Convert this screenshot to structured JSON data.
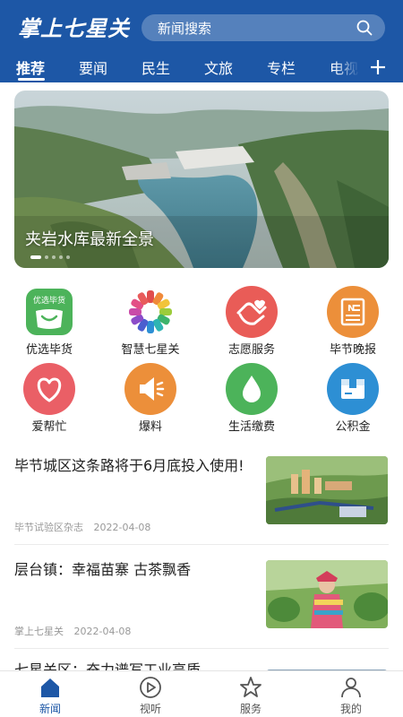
{
  "header": {
    "logo_text": "掌上七星关",
    "search_placeholder": "新闻搜索"
  },
  "tabs": [
    {
      "label": "推荐",
      "active": true
    },
    {
      "label": "要闻"
    },
    {
      "label": "民生"
    },
    {
      "label": "文旅"
    },
    {
      "label": "专栏"
    },
    {
      "label": "电视"
    }
  ],
  "banner": {
    "caption": "夹岩水库最新全景",
    "slide_count": 5,
    "active_slide": 1
  },
  "services": [
    {
      "label": "优选毕货",
      "icon": "shopping-bag-icon",
      "badge": "优选毕货",
      "color": "#4cb35a"
    },
    {
      "label": "智慧七星关",
      "icon": "colorful-flower-icon",
      "color": "#e04d4d"
    },
    {
      "label": "志愿服务",
      "icon": "heart-hand-icon",
      "color": "#e95c57"
    },
    {
      "label": "毕节晚报",
      "icon": "newspaper-icon",
      "color": "#ec8f3a"
    },
    {
      "label": "爱帮忙",
      "icon": "heart-icon",
      "color": "#ea5f66"
    },
    {
      "label": "爆料",
      "icon": "megaphone-icon",
      "color": "#ec8f3a"
    },
    {
      "label": "生活缴费",
      "icon": "water-drop-icon",
      "color": "#4cb35a"
    },
    {
      "label": "公积金",
      "icon": "box-icon",
      "color": "#2d8fd4"
    }
  ],
  "news": [
    {
      "title": "毕节城区这条路将于6月底投入使用!",
      "source": "毕节试验区杂志",
      "date": "2022-04-08"
    },
    {
      "title": "层台镇：幸福苗寨 古茶飘香",
      "source": "掌上七星关",
      "date": "2022-04-08"
    },
    {
      "title": "七星关区：奋力谱写工业高质",
      "source": "",
      "date": ""
    }
  ],
  "bottom_nav": [
    {
      "label": "新闻",
      "icon": "home-icon",
      "active": true
    },
    {
      "label": "视听",
      "icon": "play-circle-icon"
    },
    {
      "label": "服务",
      "icon": "star-icon"
    },
    {
      "label": "我的",
      "icon": "user-icon"
    }
  ],
  "colors": {
    "brand": "#1d57a6",
    "text": "#222222",
    "meta": "#999999"
  }
}
